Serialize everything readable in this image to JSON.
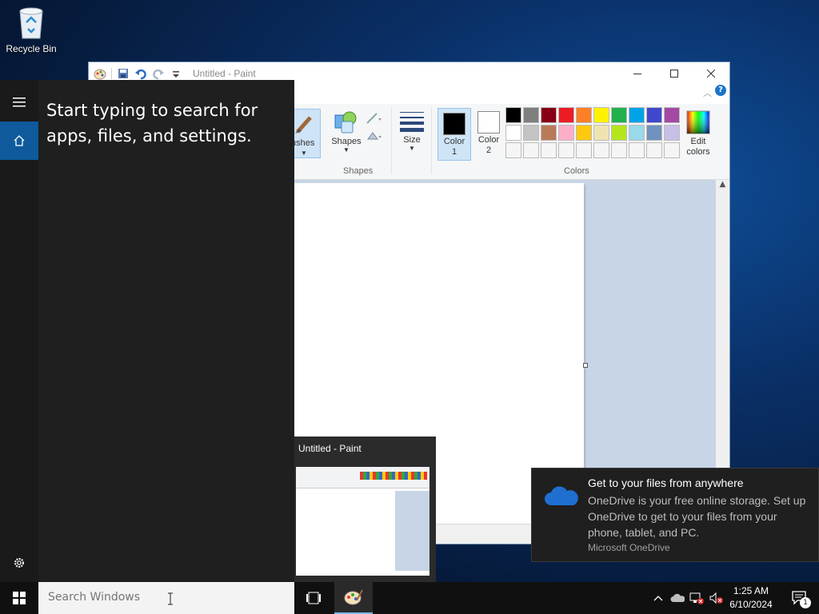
{
  "desktop": {
    "recycle_bin_label": "Recycle Bin"
  },
  "paint": {
    "window_title": "Untitled - Paint",
    "ribbon": {
      "brushes_label": "ushes",
      "shapes_label": "Shapes",
      "shapes_group_label": "Shapes",
      "size_label": "Size",
      "color1_label": "Color\n1",
      "color2_label": "Color\n2",
      "colors_group_label": "Colors",
      "edit_colors_label": "Edit\ncolors",
      "color1_value": "#000000",
      "color2_value": "#ffffff",
      "palette": [
        "#000000",
        "#7f7f7f",
        "#880015",
        "#ed1c24",
        "#ff7f27",
        "#fff200",
        "#22b14c",
        "#00a2e8",
        "#3f48cc",
        "#a349a4",
        "#ffffff",
        "#c3c3c3",
        "#b97a57",
        "#ffaec9",
        "#ffc90e",
        "#efe4b0",
        "#b5e61d",
        "#99d9ea",
        "#7092be",
        "#c8bfe7",
        "#f5f5f5",
        "#f5f5f5",
        "#f5f5f5",
        "#f5f5f5",
        "#f5f5f5",
        "#f5f5f5",
        "#f5f5f5",
        "#f5f5f5",
        "#f5f5f5",
        "#f5f5f5"
      ]
    }
  },
  "start_panel": {
    "hint_text": "Start typing to search for apps, files, and settings."
  },
  "taskbar": {
    "search_placeholder": "Search Windows",
    "time": "1:25 AM",
    "date": "6/10/2024",
    "notification_count": "1"
  },
  "thumbnail": {
    "title": "Untitled - Paint"
  },
  "toast": {
    "title": "Get to your files from anywhere",
    "body": "OneDrive is your free online storage. Set up OneDrive to get to your files from your phone, tablet, and PC.",
    "source": "Microsoft OneDrive"
  },
  "colors": {
    "accent": "#0e5a9c",
    "taskbar": "#101010",
    "start_bg": "#1f1f1f"
  }
}
